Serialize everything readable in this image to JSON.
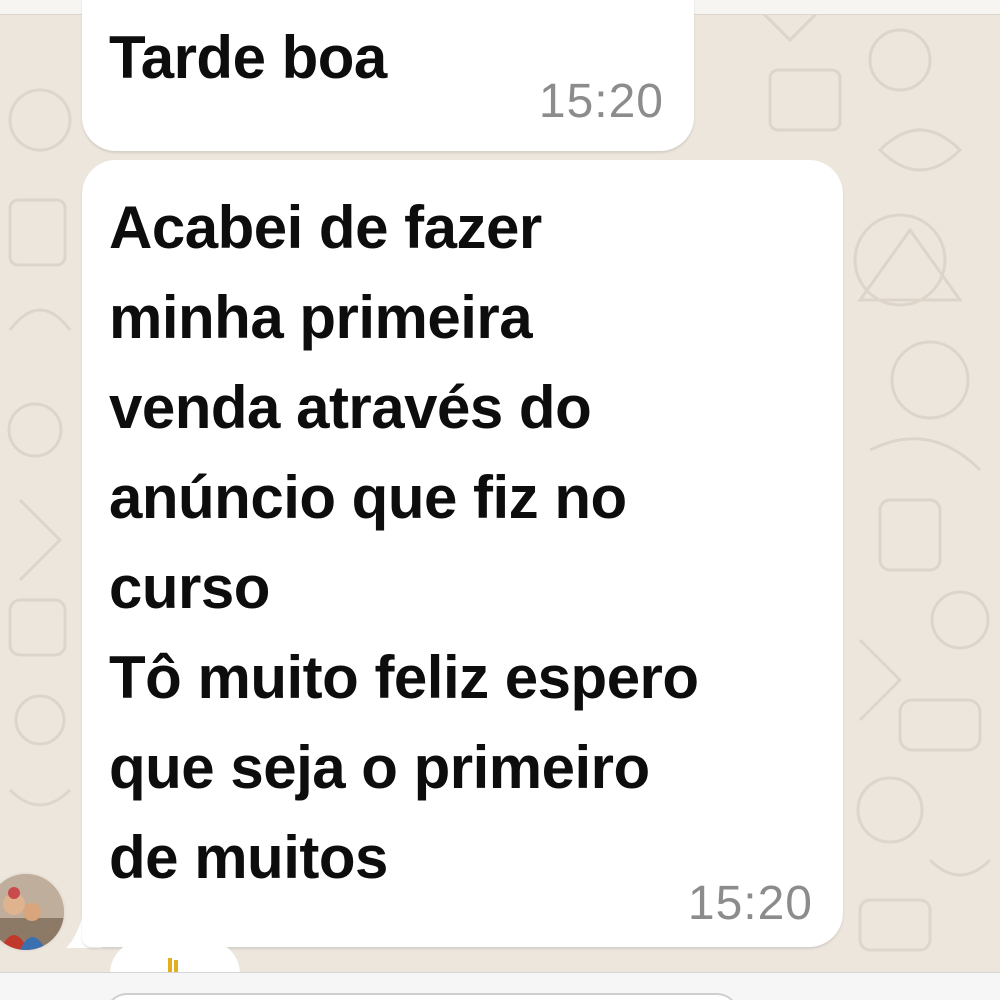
{
  "chat": {
    "messages": [
      {
        "text": "Tarde boa",
        "time": "15:20"
      },
      {
        "text": "Acabei de fazer\nminha primeira\nvenda através do\nanúncio que fiz no\ncurso\nTô muito feliz espero\nque seja o primeiro\nde muitos",
        "time": "15:20"
      }
    ],
    "sender_avatar_icon": "user-avatar-photo",
    "next_message_icon": "emoji-sticker-icon"
  },
  "colors": {
    "background": "#ece6dd",
    "bubble": "#ffffff",
    "text": "#0d0d0d",
    "timestamp": "#8c8c8c"
  }
}
